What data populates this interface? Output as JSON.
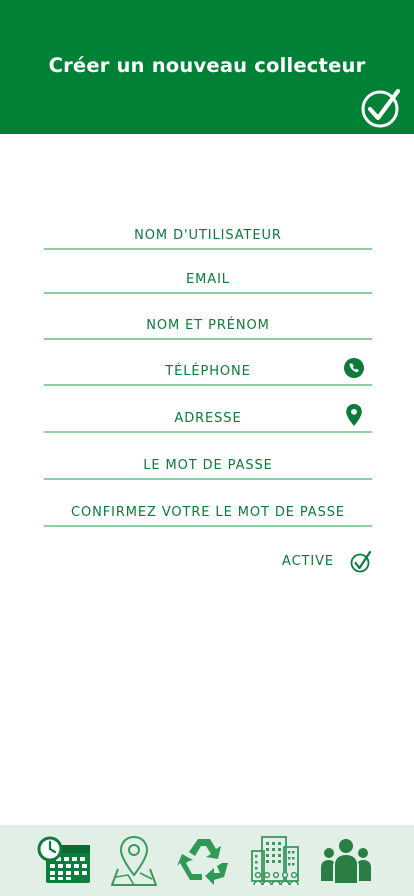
{
  "header": {
    "title": "Créer un nouveau collecteur",
    "save_icon": "check-circle-icon",
    "background": "#018136"
  },
  "form": {
    "fields": [
      {
        "label": "NOM D'UTILISATEUR"
      },
      {
        "label": "EMAIL"
      },
      {
        "label": "NOM ET PRÉNOM"
      },
      {
        "label": "TÉLÉPHONE",
        "icon": "phone-icon"
      },
      {
        "label": "ADRESSE",
        "icon": "location-pin-icon"
      },
      {
        "label": "LE MOT DE PASSE"
      },
      {
        "label": "CONFIRMEZ VOTRE LE MOT DE PASSE"
      }
    ],
    "active": {
      "label": "ACTIVE",
      "icon": "check-circle-icon"
    },
    "accent": "#0b7a3b",
    "underline": "#8fcfa6"
  },
  "bottom_nav": {
    "background": "#e2efe6",
    "items": [
      {
        "icon": "calendar-clock-icon"
      },
      {
        "icon": "map-pin-icon"
      },
      {
        "icon": "recycle-icon"
      },
      {
        "icon": "buildings-icon"
      },
      {
        "icon": "users-group-icon"
      }
    ]
  }
}
